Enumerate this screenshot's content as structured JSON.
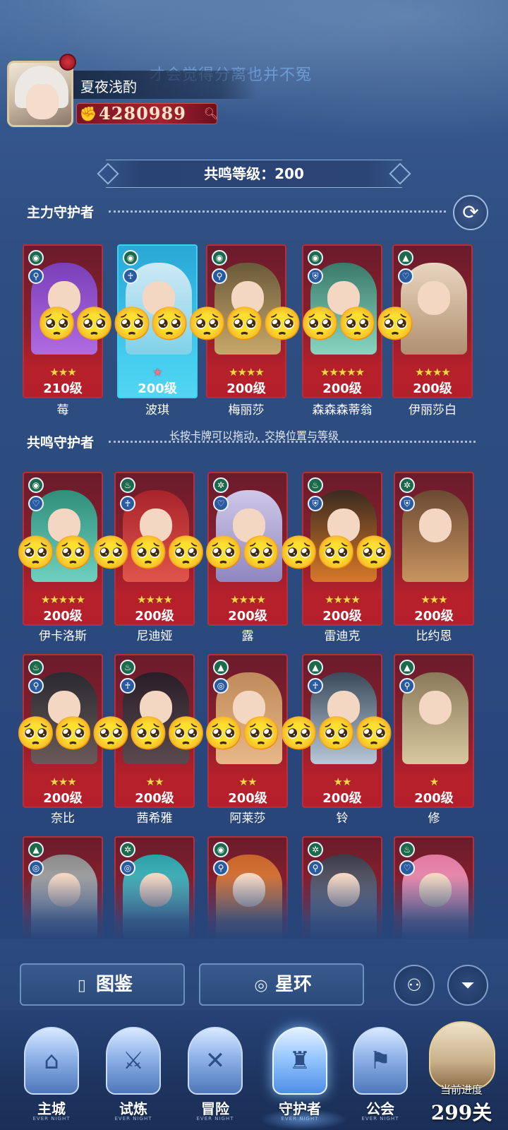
{
  "lyric_overlay": "才会觉得分离也并不冤",
  "player": {
    "name": "夏夜浅酌",
    "power": "4280989"
  },
  "resonance_level": "共鸣等级：200",
  "sections": {
    "main_title": "主力守护者",
    "resonance_title": "共鸣守护者"
  },
  "hint": "长按卡牌可以拖动，交换位置与等级",
  "main_heroes": [
    {
      "name": "莓",
      "level": "210级",
      "stars": "★★★",
      "el1": "◉",
      "el2": "⚲"
    },
    {
      "name": "波琪",
      "level": "200级",
      "stars": "★",
      "el1": "◉",
      "el2": "♰"
    },
    {
      "name": "梅丽莎",
      "level": "200级",
      "stars": "★★★★",
      "el1": "◉",
      "el2": "⚲"
    },
    {
      "name": "森森森蒂翁",
      "level": "200级",
      "stars": "★★★★★",
      "el1": "◉",
      "el2": "⛨"
    },
    {
      "name": "伊丽莎白",
      "level": "200级",
      "stars": "★★★★",
      "el1": "▲",
      "el2": "♡"
    }
  ],
  "resonance_heroes_row1": [
    {
      "name": "伊卡洛斯",
      "level": "200级",
      "stars": "★★★★★",
      "el1": "◉",
      "el2": "♡"
    },
    {
      "name": "尼迪娅",
      "level": "200级",
      "stars": "★★★★",
      "el1": "♨",
      "el2": "♰"
    },
    {
      "name": "露",
      "level": "200级",
      "stars": "★★★★",
      "el1": "✲",
      "el2": "♡"
    },
    {
      "name": "雷迪克",
      "level": "200级",
      "stars": "★★★★",
      "el1": "♨",
      "el2": "⛨"
    },
    {
      "name": "比约恩",
      "level": "200级",
      "stars": "★★★",
      "el1": "✲",
      "el2": "⛨"
    }
  ],
  "resonance_heroes_row2": [
    {
      "name": "奈比",
      "level": "200级",
      "stars": "★★★",
      "el1": "♨",
      "el2": "⚲"
    },
    {
      "name": "茜希雅",
      "level": "200级",
      "stars": "★★",
      "el1": "♨",
      "el2": "♰"
    },
    {
      "name": "阿莱莎",
      "level": "200级",
      "stars": "★★",
      "el1": "▲",
      "el2": "◎"
    },
    {
      "name": "铃",
      "level": "200级",
      "stars": "★★",
      "el1": "▲",
      "el2": "♰"
    },
    {
      "name": "修",
      "level": "200级",
      "stars": "★",
      "el1": "▲",
      "el2": "⚲"
    }
  ],
  "resonance_heroes_row3": [
    {
      "el1": "▲",
      "el2": "◎"
    },
    {
      "el1": "✲",
      "el2": "◎"
    },
    {
      "el1": "◉",
      "el2": "⚲"
    },
    {
      "el1": "✲",
      "el2": "⚲"
    },
    {
      "el1": "♨",
      "el2": "♡"
    }
  ],
  "emoji": "🥺",
  "buttons": {
    "codex": "图鉴",
    "star_ring": "星环"
  },
  "nav": [
    {
      "label": "主城",
      "sub": "EVER NIGHT"
    },
    {
      "label": "试炼",
      "sub": "EVER NIGHT"
    },
    {
      "label": "冒险",
      "sub": "EVER NIGHT"
    },
    {
      "label": "守护者",
      "sub": "EVER NIGHT"
    },
    {
      "label": "公会",
      "sub": "EVER NIGHT"
    }
  ],
  "progress": {
    "label": "当前进度",
    "value": "299关"
  },
  "colors": {
    "card_red": "#b41f2b",
    "card_blue": "#3bc4ea",
    "background": "#2b4a7e",
    "star": "#ffd24a"
  }
}
